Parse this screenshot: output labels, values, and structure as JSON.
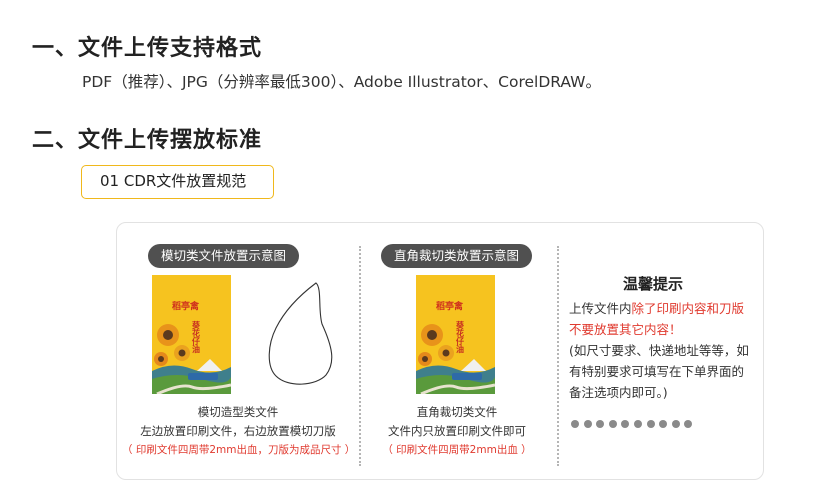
{
  "section1": {
    "title": "一、文件上传支持格式",
    "formats_line": "PDF（推荐）、JPG（分辨率最低300）、Adobe Illustrator、CorelDRAW。"
  },
  "section2": {
    "title": "二、文件上传摆放标准",
    "tab_label": "01  CDR文件放置规范"
  },
  "panel_left": {
    "pill": "模切类文件放置示意图",
    "caption_title": "模切造型类文件",
    "caption_line": "左边放置印刷文件，右边放置模切刀版",
    "caption_note": "（ 印刷文件四周带2mm出血，刀版为成品尺寸 ）"
  },
  "panel_mid": {
    "pill": "直角裁切类放置示意图",
    "caption_title": "直角裁切类文件",
    "caption_line": "文件内只放置印刷文件即可",
    "caption_note": "（ 印刷文件四周带2mm出血 ）"
  },
  "poster": {
    "brand": "稻亭禽",
    "slogan": "葵花仔油"
  },
  "tips": {
    "title": "温馨提示",
    "line1_prefix": "上传文件内",
    "line1_red": "除了印刷内容和刀版不要放置其它内容！",
    "line2": "(如尺寸要求、快递地址等等，如有特别要求可填写在下单界面的备注选项内即可。)",
    "dot_count": 10
  },
  "colors": {
    "accent_yellow": "#f0b81c",
    "warning_red": "#e03a2f",
    "pill_bg": "#505050"
  }
}
